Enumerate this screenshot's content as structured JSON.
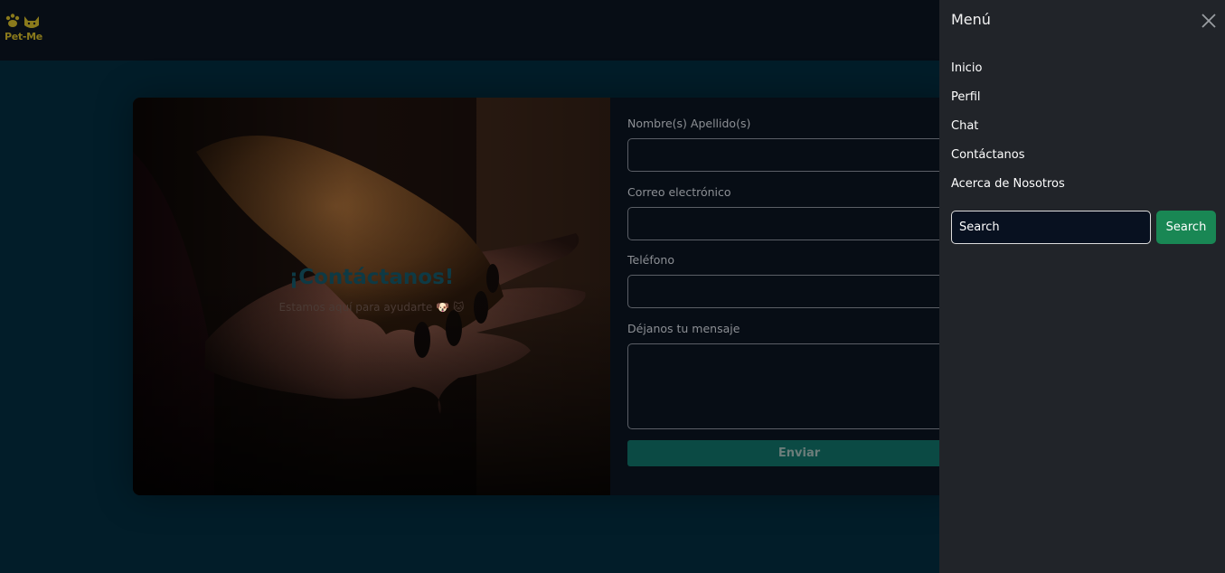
{
  "brand": {
    "name": "Pet-Me",
    "logo_icon": "paw-cat-icon",
    "color": "#8a7a1c"
  },
  "hero": {
    "title": "¡Contáctanos!",
    "subtitle": "Estamos aquí para ayudarte 🐶 🐱"
  },
  "form": {
    "name_label": "Nombre(s) Apellido(s)",
    "email_label": "Correo electrónico",
    "phone_label": "Teléfono",
    "message_label": "Déjanos tu mensaje",
    "submit_label": "Enviar"
  },
  "menu": {
    "title": "Menú",
    "close_icon": "close-icon",
    "items": [
      {
        "label": "Inicio"
      },
      {
        "label": "Perfil"
      },
      {
        "label": "Chat"
      },
      {
        "label": "Contáctanos"
      },
      {
        "label": "Acerca de Nosotros"
      }
    ],
    "search": {
      "value": "Search",
      "button_label": "Search"
    }
  },
  "colors": {
    "accent": "#198754",
    "submit": "#0b4a44",
    "background": "#021d29",
    "panel": "#212429"
  }
}
